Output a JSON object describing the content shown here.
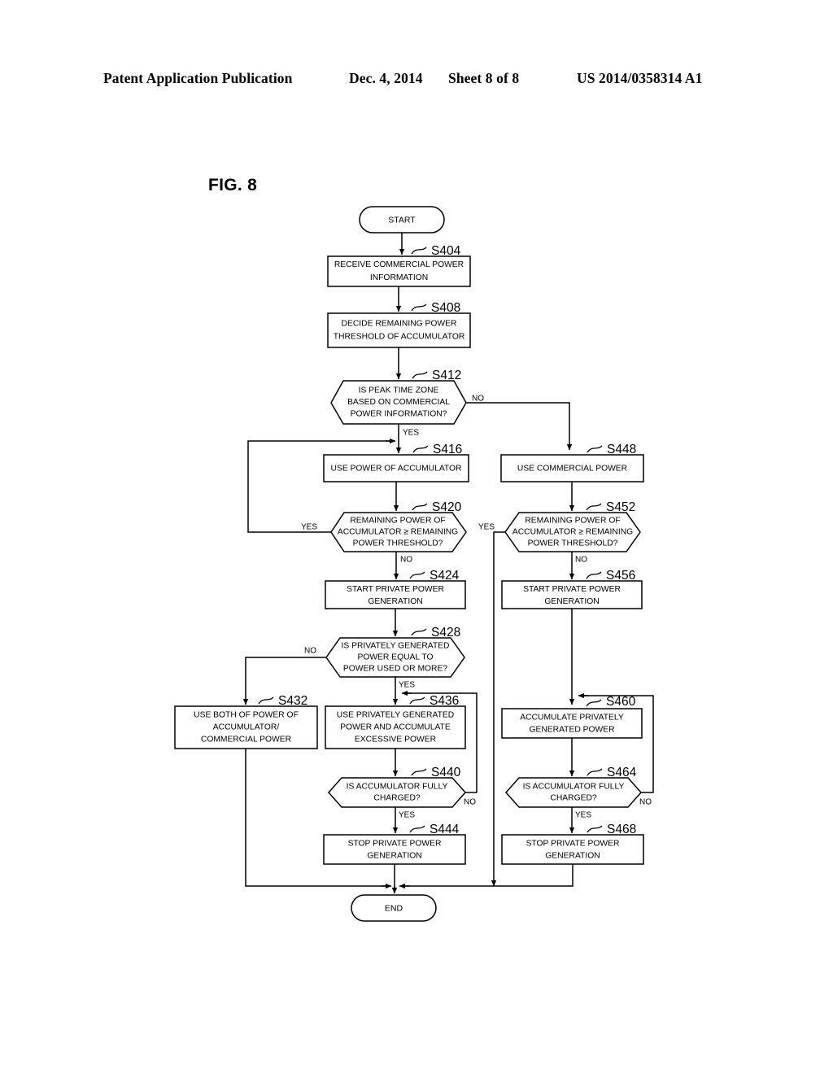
{
  "header": {
    "publication": "Patent Application Publication",
    "date": "Dec. 4, 2014",
    "sheet": "Sheet 8 of 8",
    "patent_number": "US 2014/0358314 A1"
  },
  "figure": {
    "label": "FIG. 8"
  },
  "flowchart": {
    "start_label": "START",
    "end_label": "END",
    "yes_label": "YES",
    "no_label": "NO",
    "nodes": [
      {
        "id": "S404",
        "tag": "S404",
        "type": "process",
        "lines": [
          "RECEIVE COMMERCIAL POWER",
          "INFORMATION"
        ]
      },
      {
        "id": "S408",
        "tag": "S408",
        "type": "process",
        "lines": [
          "DECIDE REMAINING POWER",
          "THRESHOLD OF ACCUMULATOR"
        ]
      },
      {
        "id": "S412",
        "tag": "S412",
        "type": "decision",
        "lines": [
          "IS PEAK TIME ZONE",
          "BASED ON COMMERCIAL",
          "POWER INFORMATION?"
        ]
      },
      {
        "id": "S416",
        "tag": "S416",
        "type": "process",
        "lines": [
          "USE POWER OF ACCUMULATOR"
        ]
      },
      {
        "id": "S420",
        "tag": "S420",
        "type": "decision",
        "lines": [
          "REMAINING POWER OF",
          "ACCUMULATOR ≥ REMAINING",
          "POWER THRESHOLD?"
        ]
      },
      {
        "id": "S424",
        "tag": "S424",
        "type": "process",
        "lines": [
          "START PRIVATE POWER",
          "GENERATION"
        ]
      },
      {
        "id": "S428",
        "tag": "S428",
        "type": "decision",
        "lines": [
          "IS PRIVATELY GENERATED",
          "POWER EQUAL TO",
          "POWER USED OR MORE?"
        ]
      },
      {
        "id": "S432",
        "tag": "S432",
        "type": "process",
        "lines": [
          "USE BOTH OF POWER OF",
          "ACCUMULATOR/",
          "COMMERCIAL POWER"
        ]
      },
      {
        "id": "S436",
        "tag": "S436",
        "type": "process",
        "lines": [
          "USE PRIVATELY GENERATED",
          "POWER AND ACCUMULATE",
          "EXCESSIVE POWER"
        ]
      },
      {
        "id": "S440",
        "tag": "S440",
        "type": "decision",
        "lines": [
          "IS ACCUMULATOR FULLY",
          "CHARGED?"
        ]
      },
      {
        "id": "S444",
        "tag": "S444",
        "type": "process",
        "lines": [
          "STOP PRIVATE POWER",
          "GENERATION"
        ]
      },
      {
        "id": "S448",
        "tag": "S448",
        "type": "process",
        "lines": [
          "USE COMMERCIAL POWER"
        ]
      },
      {
        "id": "S452",
        "tag": "S452",
        "type": "decision",
        "lines": [
          "REMAINING POWER OF",
          "ACCUMULATOR ≥ REMAINING",
          "POWER THRESHOLD?"
        ]
      },
      {
        "id": "S456",
        "tag": "S456",
        "type": "process",
        "lines": [
          "START PRIVATE POWER",
          "GENERATION"
        ]
      },
      {
        "id": "S460",
        "tag": "S460",
        "type": "process",
        "lines": [
          "ACCUMULATE PRIVATELY",
          "GENERATED POWER"
        ]
      },
      {
        "id": "S464",
        "tag": "S464",
        "type": "decision",
        "lines": [
          "IS ACCUMULATOR FULLY",
          "CHARGED?"
        ]
      },
      {
        "id": "S468",
        "tag": "S468",
        "type": "process",
        "lines": [
          "STOP PRIVATE POWER",
          "GENERATION"
        ]
      }
    ]
  },
  "colors": {
    "ink": "#000000",
    "paper": "#ffffff"
  }
}
